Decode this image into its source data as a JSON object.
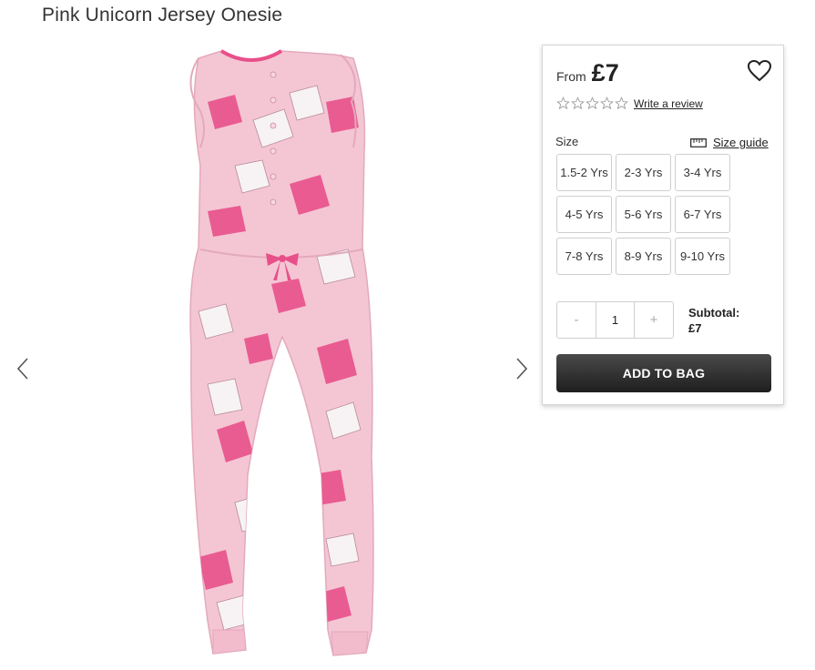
{
  "product": {
    "title": "Pink Unicorn Jersey Onesie"
  },
  "price": {
    "from_label": "From",
    "value": "£7"
  },
  "rating": {
    "stars_filled": 0,
    "stars_total": 5,
    "write_review": "Write a review"
  },
  "size": {
    "label": "Size",
    "guide_label": "Size guide",
    "options": [
      "1.5-2 Yrs",
      "2-3 Yrs",
      "3-4 Yrs",
      "4-5 Yrs",
      "5-6 Yrs",
      "6-7 Yrs",
      "7-8 Yrs",
      "8-9 Yrs",
      "9-10 Yrs"
    ]
  },
  "quantity": {
    "minus": "-",
    "value": "1",
    "plus": "+"
  },
  "subtotal": {
    "label": "Subtotal:",
    "value": "£7"
  },
  "actions": {
    "add_to_bag": "ADD TO BAG"
  },
  "icons": {
    "prev": "chevron-left-icon",
    "next": "chevron-right-icon",
    "wishlist": "heart-icon",
    "ruler": "ruler-icon",
    "star": "star-outline-icon"
  },
  "colors": {
    "button_dark": "#1e1e1e",
    "garment_pink": "#f4c6d4",
    "accent_pink": "#e8508a"
  }
}
